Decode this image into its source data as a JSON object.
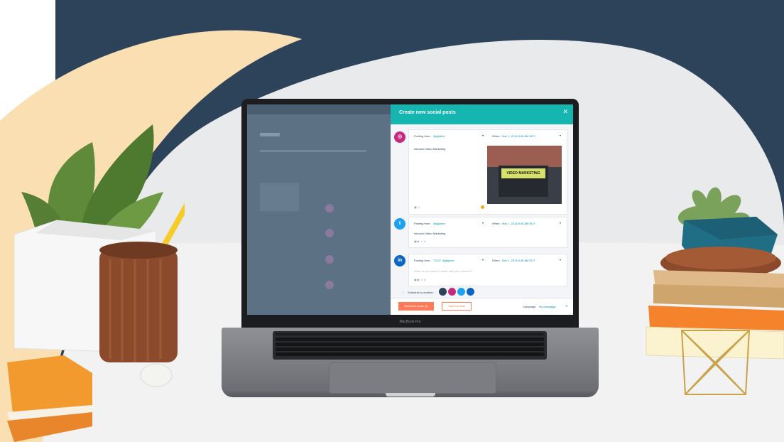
{
  "colors": {
    "navy": "#2d4359",
    "cream": "#f9dfb2",
    "accent_teal": "#16b6b0",
    "accent_orange": "#ff7a59"
  },
  "laptop": {
    "brand": "MacBook Pro"
  },
  "modal": {
    "title": "Create new social posts",
    "close_icon": "close-icon",
    "posts": [
      {
        "network": "instagram",
        "icon": "instagram-icon",
        "posting_from_label": "Posting from:",
        "account": "@gilphex",
        "when_label": "When:",
        "when_value": "Nov 1, 2018 9:36 AM EDT",
        "body": "Inbound Video Marketing",
        "image_caption": "VIDEO MARKETING"
      },
      {
        "network": "twitter",
        "icon": "twitter-icon",
        "posting_from_label": "Posting from:",
        "account": "@gilphex",
        "when_label": "When:",
        "when_value": "Nov 1, 2018 9:36 AM EDT",
        "body": "Inbound Video Marketing"
      },
      {
        "network": "linkedin",
        "icon": "linkedin-icon",
        "posting_from_label": "Posting from:",
        "account": "\"2013\" @gilphex",
        "when_label": "When:",
        "when_value": "Nov 1, 2018 9:36 AM EDT",
        "placeholder": "What do you want to share with your network?"
      }
    ],
    "schedule_another_label": "Schedule to another:",
    "schedule_button": "Schedule posts (3)",
    "draft_button": "Save as draft",
    "campaign_label": "Campaign:",
    "campaign_value": "No campaign"
  }
}
